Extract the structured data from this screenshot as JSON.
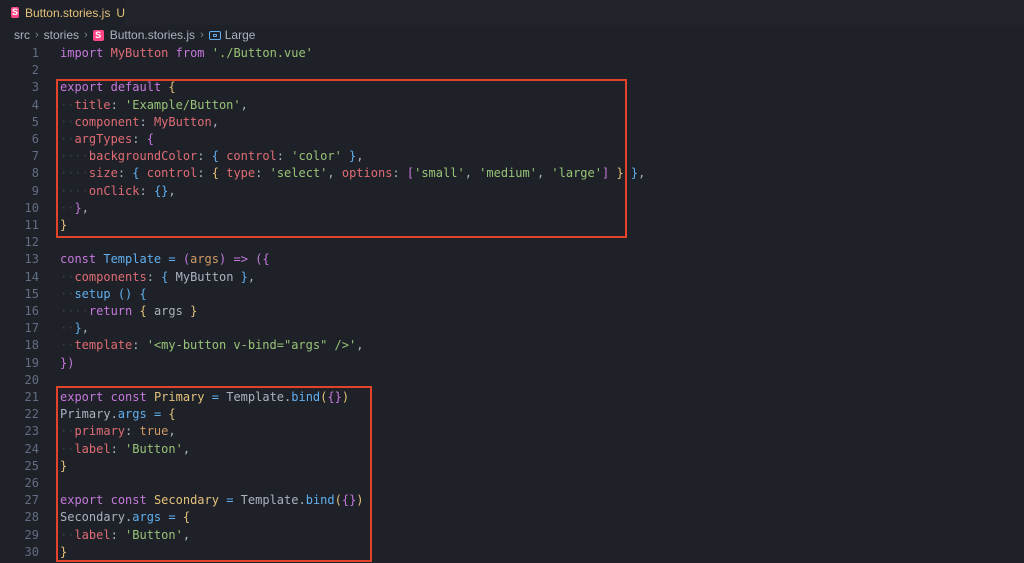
{
  "tab": {
    "title": "Button.stories.js",
    "badge": "U",
    "icon": "storybook-icon"
  },
  "breadcrumb": {
    "items": [
      "src",
      "stories",
      "Button.stories.js",
      "Large"
    ],
    "icons": [
      "",
      "",
      "storybook-icon",
      "symbol-variable-icon"
    ]
  },
  "colors": {
    "keyword": "#c678dd",
    "variable": "#e06c75",
    "string": "#98c379",
    "function": "#61afef",
    "constant": "#d19a66",
    "text": "#abb2bf",
    "highlight_box": "#e2432a"
  },
  "code_lines": [
    {
      "n": "1",
      "tokens": [
        {
          "t": "import",
          "c": "k"
        },
        {
          "t": " "
        },
        {
          "t": "MyButton",
          "c": "v"
        },
        {
          "t": " "
        },
        {
          "t": "from",
          "c": "k"
        },
        {
          "t": " "
        },
        {
          "t": "'./Button.vue'",
          "c": "s"
        }
      ]
    },
    {
      "n": "2",
      "tokens": []
    },
    {
      "n": "3",
      "tokens": [
        {
          "t": "export",
          "c": "k"
        },
        {
          "t": " "
        },
        {
          "t": "default",
          "c": "k"
        },
        {
          "t": " "
        },
        {
          "t": "{",
          "c": "y"
        }
      ]
    },
    {
      "n": "4",
      "tokens": [
        {
          "t": "··",
          "c": "i"
        },
        {
          "t": "title",
          "c": "v"
        },
        {
          "t": ": "
        },
        {
          "t": "'Example/Button'",
          "c": "s"
        },
        {
          "t": ","
        }
      ]
    },
    {
      "n": "5",
      "tokens": [
        {
          "t": "··",
          "c": "i"
        },
        {
          "t": "component",
          "c": "v"
        },
        {
          "t": ": "
        },
        {
          "t": "MyButton",
          "c": "v"
        },
        {
          "t": ","
        }
      ]
    },
    {
      "n": "6",
      "tokens": [
        {
          "t": "··",
          "c": "i"
        },
        {
          "t": "argTypes",
          "c": "v"
        },
        {
          "t": ": "
        },
        {
          "t": "{",
          "c": "k"
        }
      ]
    },
    {
      "n": "7",
      "tokens": [
        {
          "t": "····",
          "c": "i"
        },
        {
          "t": "backgroundColor",
          "c": "v"
        },
        {
          "t": ": "
        },
        {
          "t": "{",
          "c": "f"
        },
        {
          "t": " "
        },
        {
          "t": "control",
          "c": "v"
        },
        {
          "t": ": "
        },
        {
          "t": "'color'",
          "c": "s"
        },
        {
          "t": " "
        },
        {
          "t": "}",
          "c": "f"
        },
        {
          "t": ","
        }
      ]
    },
    {
      "n": "8",
      "tokens": [
        {
          "t": "····",
          "c": "i"
        },
        {
          "t": "size",
          "c": "v"
        },
        {
          "t": ": "
        },
        {
          "t": "{",
          "c": "f"
        },
        {
          "t": " "
        },
        {
          "t": "control",
          "c": "v"
        },
        {
          "t": ": "
        },
        {
          "t": "{",
          "c": "y"
        },
        {
          "t": " "
        },
        {
          "t": "type",
          "c": "v"
        },
        {
          "t": ": "
        },
        {
          "t": "'select'",
          "c": "s"
        },
        {
          "t": ", "
        },
        {
          "t": "options",
          "c": "v"
        },
        {
          "t": ": "
        },
        {
          "t": "[",
          "c": "k"
        },
        {
          "t": "'small'",
          "c": "s"
        },
        {
          "t": ", "
        },
        {
          "t": "'medium'",
          "c": "s"
        },
        {
          "t": ", "
        },
        {
          "t": "'large'",
          "c": "s"
        },
        {
          "t": "]",
          "c": "k"
        },
        {
          "t": " "
        },
        {
          "t": "}",
          "c": "y"
        },
        {
          "t": " "
        },
        {
          "t": "}",
          "c": "f"
        },
        {
          "t": ","
        }
      ]
    },
    {
      "n": "9",
      "tokens": [
        {
          "t": "····",
          "c": "i"
        },
        {
          "t": "onClick",
          "c": "v"
        },
        {
          "t": ": "
        },
        {
          "t": "{}",
          "c": "f"
        },
        {
          "t": ","
        }
      ]
    },
    {
      "n": "10",
      "tokens": [
        {
          "t": "··",
          "c": "i"
        },
        {
          "t": "}",
          "c": "k"
        },
        {
          "t": ","
        }
      ]
    },
    {
      "n": "11",
      "tokens": [
        {
          "t": "}",
          "c": "y"
        }
      ]
    },
    {
      "n": "12",
      "tokens": []
    },
    {
      "n": "13",
      "tokens": [
        {
          "t": "const",
          "c": "k"
        },
        {
          "t": " "
        },
        {
          "t": "Template",
          "c": "f"
        },
        {
          "t": " "
        },
        {
          "t": "=",
          "c": "f"
        },
        {
          "t": " "
        },
        {
          "t": "(",
          "c": "k"
        },
        {
          "t": "args",
          "c": "o"
        },
        {
          "t": ")",
          "c": "k"
        },
        {
          "t": " "
        },
        {
          "t": "=>",
          "c": "k"
        },
        {
          "t": " "
        },
        {
          "t": "({",
          "c": "k"
        }
      ]
    },
    {
      "n": "14",
      "tokens": [
        {
          "t": "··",
          "c": "i"
        },
        {
          "t": "components",
          "c": "v"
        },
        {
          "t": ": "
        },
        {
          "t": "{",
          "c": "f"
        },
        {
          "t": " MyButton "
        },
        {
          "t": "}",
          "c": "f"
        },
        {
          "t": ","
        }
      ]
    },
    {
      "n": "15",
      "tokens": [
        {
          "t": "··",
          "c": "i"
        },
        {
          "t": "setup",
          "c": "f"
        },
        {
          "t": " "
        },
        {
          "t": "()",
          "c": "f"
        },
        {
          "t": " "
        },
        {
          "t": "{",
          "c": "f"
        }
      ]
    },
    {
      "n": "16",
      "tokens": [
        {
          "t": "····",
          "c": "i"
        },
        {
          "t": "return",
          "c": "k"
        },
        {
          "t": " "
        },
        {
          "t": "{",
          "c": "y"
        },
        {
          "t": " args "
        },
        {
          "t": "}",
          "c": "y"
        }
      ]
    },
    {
      "n": "17",
      "tokens": [
        {
          "t": "··",
          "c": "i"
        },
        {
          "t": "}",
          "c": "f"
        },
        {
          "t": ","
        }
      ]
    },
    {
      "n": "18",
      "tokens": [
        {
          "t": "··",
          "c": "i"
        },
        {
          "t": "template",
          "c": "v"
        },
        {
          "t": ": "
        },
        {
          "t": "'<my-button v-bind=\"args\" />'",
          "c": "s"
        },
        {
          "t": ","
        }
      ]
    },
    {
      "n": "19",
      "tokens": [
        {
          "t": "})",
          "c": "k"
        }
      ]
    },
    {
      "n": "20",
      "tokens": []
    },
    {
      "n": "21",
      "tokens": [
        {
          "t": "export",
          "c": "k"
        },
        {
          "t": " "
        },
        {
          "t": "const",
          "c": "k"
        },
        {
          "t": " "
        },
        {
          "t": "Primary",
          "c": "y"
        },
        {
          "t": " "
        },
        {
          "t": "=",
          "c": "f"
        },
        {
          "t": " Template."
        },
        {
          "t": "bind",
          "c": "f"
        },
        {
          "t": "(",
          "c": "y"
        },
        {
          "t": "{}",
          "c": "k"
        },
        {
          "t": ")",
          "c": "y"
        }
      ]
    },
    {
      "n": "22",
      "tokens": [
        {
          "t": "Primary."
        },
        {
          "t": "args",
          "c": "f"
        },
        {
          "t": " "
        },
        {
          "t": "=",
          "c": "f"
        },
        {
          "t": " "
        },
        {
          "t": "{",
          "c": "y"
        }
      ]
    },
    {
      "n": "23",
      "tokens": [
        {
          "t": "··",
          "c": "i"
        },
        {
          "t": "primary",
          "c": "v"
        },
        {
          "t": ": "
        },
        {
          "t": "true",
          "c": "o"
        },
        {
          "t": ","
        }
      ]
    },
    {
      "n": "24",
      "tokens": [
        {
          "t": "··",
          "c": "i"
        },
        {
          "t": "label",
          "c": "v"
        },
        {
          "t": ": "
        },
        {
          "t": "'Button'",
          "c": "s"
        },
        {
          "t": ","
        }
      ]
    },
    {
      "n": "25",
      "tokens": [
        {
          "t": "}",
          "c": "y"
        }
      ]
    },
    {
      "n": "26",
      "tokens": []
    },
    {
      "n": "27",
      "tokens": [
        {
          "t": "export",
          "c": "k"
        },
        {
          "t": " "
        },
        {
          "t": "const",
          "c": "k"
        },
        {
          "t": " "
        },
        {
          "t": "Secondary",
          "c": "y"
        },
        {
          "t": " "
        },
        {
          "t": "=",
          "c": "f"
        },
        {
          "t": " Template."
        },
        {
          "t": "bind",
          "c": "f"
        },
        {
          "t": "(",
          "c": "y"
        },
        {
          "t": "{}",
          "c": "k"
        },
        {
          "t": ")",
          "c": "y"
        }
      ]
    },
    {
      "n": "28",
      "tokens": [
        {
          "t": "Secondary."
        },
        {
          "t": "args",
          "c": "f"
        },
        {
          "t": " "
        },
        {
          "t": "=",
          "c": "f"
        },
        {
          "t": " "
        },
        {
          "t": "{",
          "c": "y"
        }
      ]
    },
    {
      "n": "29",
      "tokens": [
        {
          "t": "··",
          "c": "i"
        },
        {
          "t": "label",
          "c": "v"
        },
        {
          "t": ": "
        },
        {
          "t": "'Button'",
          "c": "s"
        },
        {
          "t": ","
        }
      ]
    },
    {
      "n": "30",
      "tokens": [
        {
          "t": "}",
          "c": "y"
        }
      ]
    }
  ]
}
